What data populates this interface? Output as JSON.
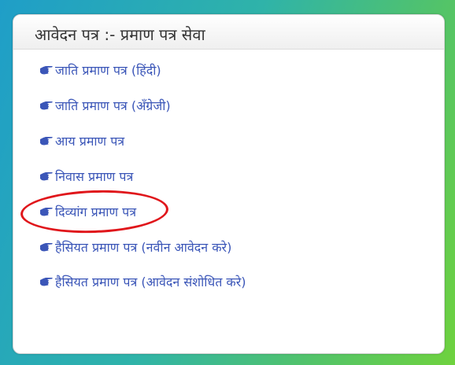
{
  "panel": {
    "title": "आवेदन पत्र :-  प्रमाण पत्र सेवा",
    "accent_color": "#3b56b8",
    "highlight_color": "#e0161b",
    "items": [
      {
        "label": "जाति प्रमाण पत्र (हिंदी)",
        "icon": "pointing-hand-icon"
      },
      {
        "label": "जाति प्रमाण पत्र (अँग्रेजी)",
        "icon": "pointing-hand-icon"
      },
      {
        "label": "आय प्रमाण पत्र",
        "icon": "pointing-hand-icon"
      },
      {
        "label": "निवास प्रमाण पत्र",
        "icon": "pointing-hand-icon"
      },
      {
        "label": "दिव्यांग प्रमाण पत्र",
        "icon": "pointing-hand-icon",
        "highlighted": true
      },
      {
        "label": "हैसियत प्रमाण पत्र (नवीन आवेदन करे)",
        "icon": "pointing-hand-icon"
      },
      {
        "label": "हैसियत प्रमाण पत्र (आवेदन संशोधित करे)",
        "icon": "pointing-hand-icon"
      }
    ]
  }
}
